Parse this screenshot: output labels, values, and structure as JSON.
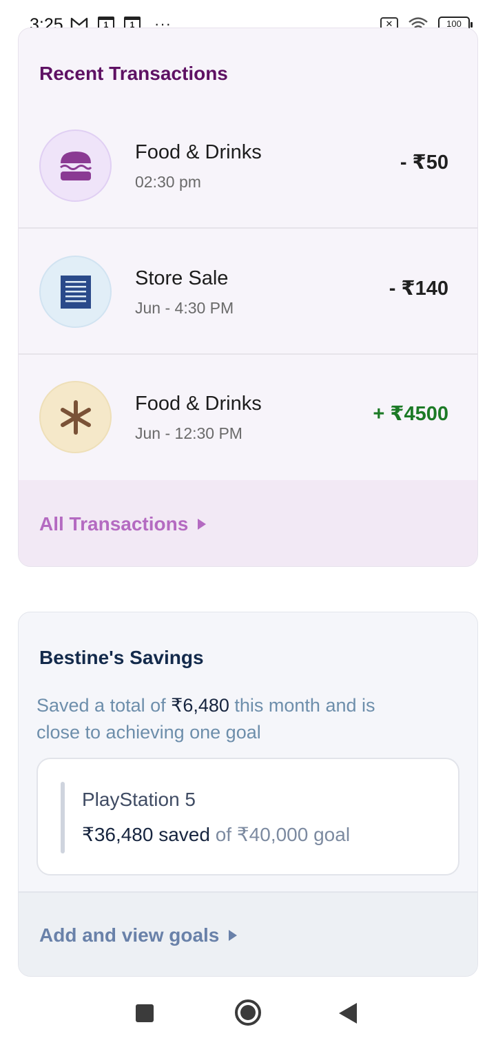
{
  "status_bar": {
    "time": "3:25",
    "calendar_day_1": "1",
    "calendar_day_2": "1",
    "more": "···",
    "battery": "100"
  },
  "transactions": {
    "title": "Recent Transactions",
    "items": [
      {
        "name": "Food & Drinks",
        "time": "02:30 pm",
        "amount": "- ₹50",
        "icon": "burger-icon",
        "icon_bg": "#efe4f9",
        "type": "debit"
      },
      {
        "name": "Store Sale",
        "time": "Jun - 4:30 PM",
        "amount": "- ₹140",
        "icon": "document-icon",
        "icon_bg": "#e1eef7",
        "type": "debit"
      },
      {
        "name": "Food & Drinks",
        "time": "Jun - 12:30 PM",
        "amount": "+ ₹4500",
        "icon": "asterisk-icon",
        "icon_bg": "#f5e8c9",
        "type": "credit"
      }
    ],
    "all_link": "All Transactions"
  },
  "savings": {
    "title": "Bestine's Savings",
    "desc_prefix": "Saved a total of ",
    "desc_amount": "₹6,480",
    "desc_suffix": " this month and is close to achieving one goal",
    "goal": {
      "name": "PlayStation 5",
      "saved_text": "₹36,480 saved",
      "goal_text": " of ₹40,000 goal"
    },
    "footer_link": "Add and view goals"
  },
  "colors": {
    "tx_title": "#5e1163",
    "tx_link": "#b46ac1",
    "credit": "#1c7a26",
    "sv_title": "#132a4b",
    "sv_link": "#6981a9"
  }
}
